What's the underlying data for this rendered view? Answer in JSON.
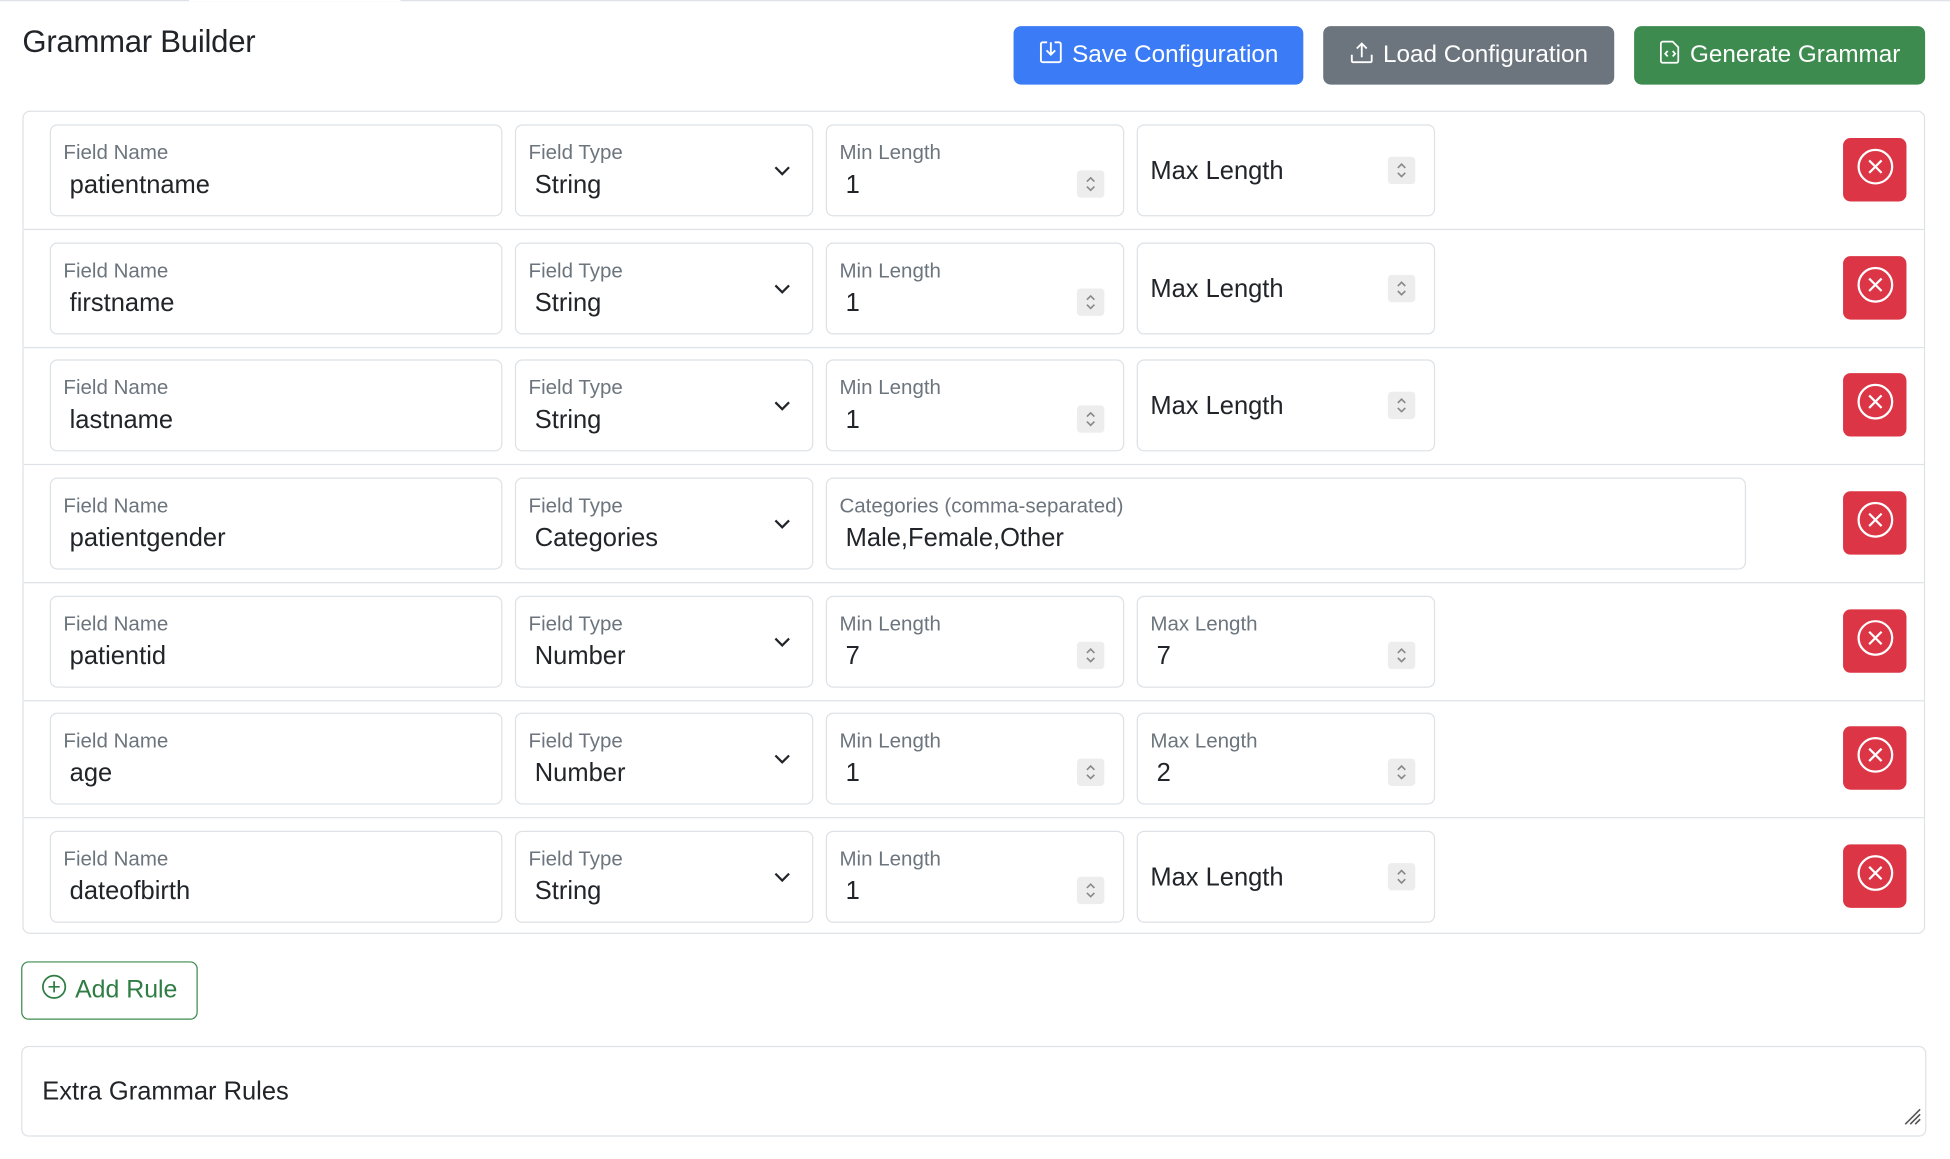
{
  "header": {
    "title": "Grammar Builder",
    "save_label": "Save Configuration",
    "load_label": "Load Configuration",
    "generate_label": "Generate Grammar"
  },
  "colors": {
    "primary": "#3b7cf6",
    "secondary": "#6c757d",
    "success": "#3d8b4f",
    "danger": "#dc3545",
    "border": "#dee2e6"
  },
  "rules": [
    {
      "field_name_label": "Field Name",
      "field_name": "patientname",
      "field_type_label": "Field Type",
      "field_type": "String",
      "min_label": "Min Length",
      "min": "1",
      "max_label": "Max Length",
      "max": ""
    },
    {
      "field_name_label": "Field Name",
      "field_name": "firstname",
      "field_type_label": "Field Type",
      "field_type": "String",
      "min_label": "Min Length",
      "min": "1",
      "max_label": "Max Length",
      "max": ""
    },
    {
      "field_name_label": "Field Name",
      "field_name": "lastname",
      "field_type_label": "Field Type",
      "field_type": "String",
      "min_label": "Min Length",
      "min": "1",
      "max_label": "Max Length",
      "max": ""
    },
    {
      "field_name_label": "Field Name",
      "field_name": "patientgender",
      "field_type_label": "Field Type",
      "field_type": "Categories",
      "categories_label": "Categories (comma-separated)",
      "categories": "Male,Female,Other"
    },
    {
      "field_name_label": "Field Name",
      "field_name": "patientid",
      "field_type_label": "Field Type",
      "field_type": "Number",
      "min_label": "Min Length",
      "min": "7",
      "max_label": "Max Length",
      "max": "7"
    },
    {
      "field_name_label": "Field Name",
      "field_name": "age",
      "field_type_label": "Field Type",
      "field_type": "Number",
      "min_label": "Min Length",
      "min": "1",
      "max_label": "Max Length",
      "max": "2"
    },
    {
      "field_name_label": "Field Name",
      "field_name": "dateofbirth",
      "field_type_label": "Field Type",
      "field_type": "String",
      "min_label": "Min Length",
      "min": "1",
      "max_label": "Max Length",
      "max": ""
    }
  ],
  "add_rule_label": "Add Rule",
  "extra": {
    "placeholder": "Extra Grammar Rules"
  },
  "icons": {
    "save": "save-icon",
    "load": "upload-icon",
    "generate": "file-code-icon",
    "delete": "x-circle-icon",
    "add": "plus-circle-icon",
    "select": "chevron-down-icon",
    "spinner": "spinner-arrows-icon"
  }
}
